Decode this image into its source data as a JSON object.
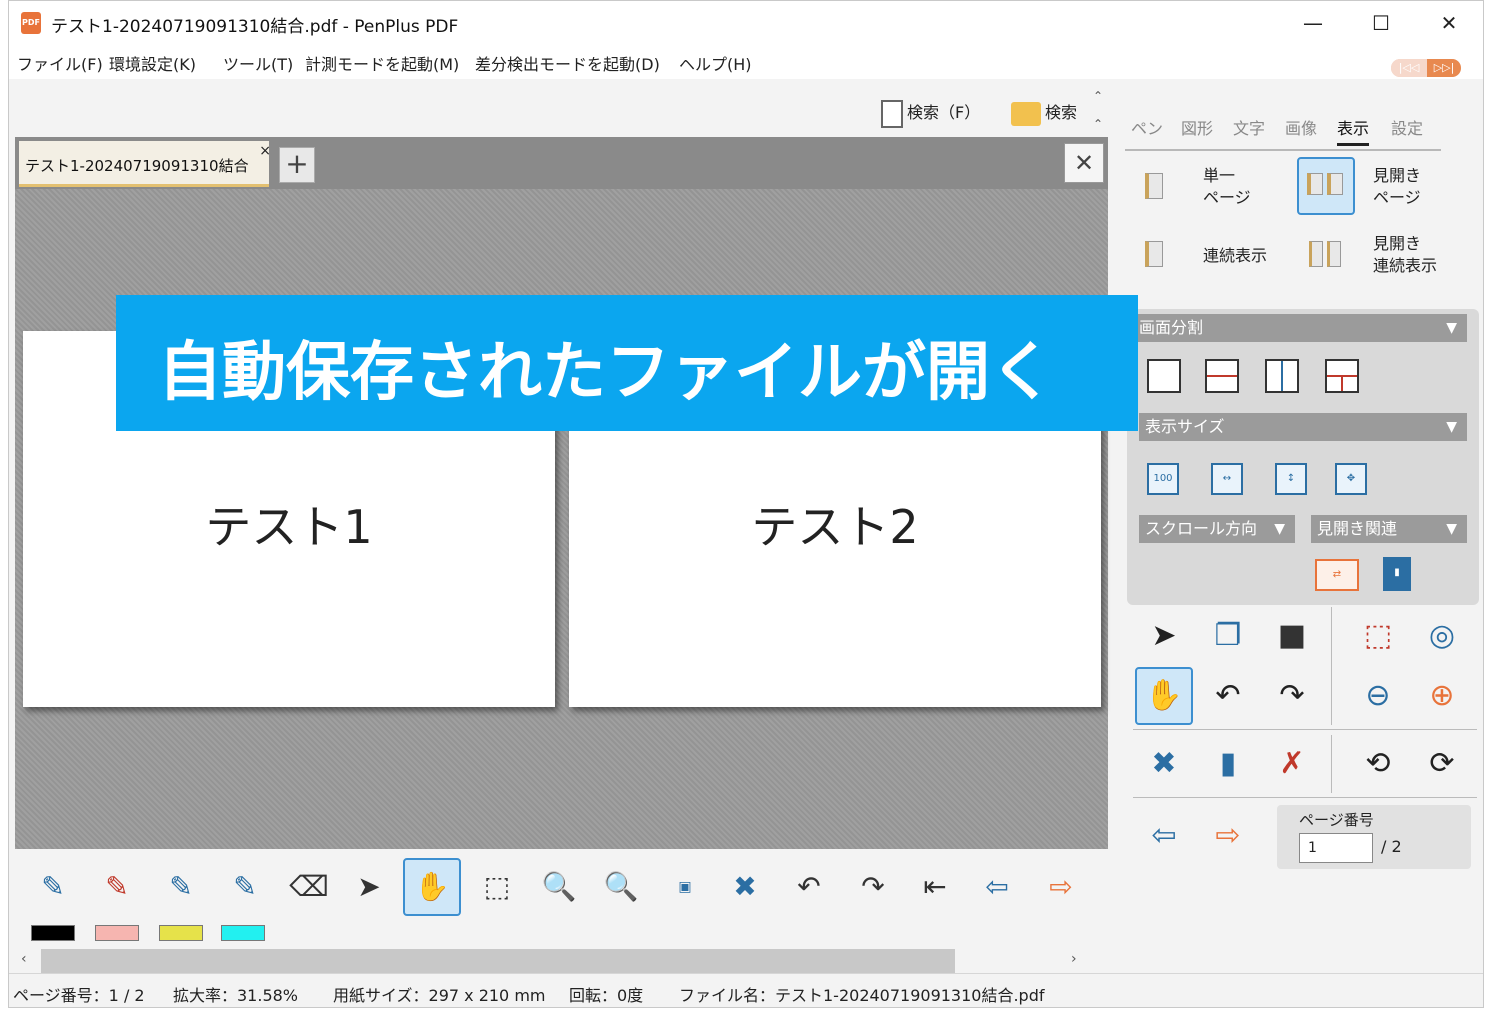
{
  "window": {
    "title": "テスト1-20240719091310結合.pdf - PenPlus PDF",
    "app_icon_label": "PDF",
    "minimize": "—",
    "maximize": "☐",
    "close": "✕"
  },
  "menu": [
    "ファイル(F)",
    "環境設定(K)",
    "ツール(T)",
    "計測モードを起動(M)",
    "差分検出モードを起動(D)",
    "ヘルプ(H)"
  ],
  "nav_pill": {
    "left": "|◁◁",
    "right": "▷▷|"
  },
  "search": {
    "text_search": "検索（F）",
    "folder_search": "検索"
  },
  "tabs": {
    "doc_tab": "テスト1-20240719091310結合",
    "tab_close": "×",
    "add": "+",
    "close_doc": "✕"
  },
  "pages": [
    {
      "text": "テスト1"
    },
    {
      "text": "テスト2"
    }
  ],
  "overlay": {
    "caption": "自動保存されたファイルが開く"
  },
  "panel": {
    "tabs": [
      "ペン",
      "図形",
      "文字",
      "画像",
      "表示",
      "設定"
    ],
    "active_tab": "表示",
    "view_modes": {
      "single_1": "単一",
      "single_2": "ページ",
      "spread_1": "見開き",
      "spread_2": "ページ",
      "continuous": "連続表示",
      "spread_cont_1": "見開き",
      "spread_cont_2": "連続表示"
    },
    "screen_split": "画面分割",
    "display_size": "表示サイズ",
    "scroll_dir": "スクロール方向",
    "spread_related": "見開き関連",
    "page_number_label": "ページ番号",
    "page_number_value": "1",
    "page_total": "/ 2"
  },
  "toolbar": {
    "swatches": [
      "#000000",
      "#f6b5b0",
      "#e6e24a",
      "#22f0f0"
    ]
  },
  "status": {
    "page": "ページ番号：1 / 2",
    "zoom": "拡大率：31.58%",
    "paper": "用紙サイズ：297 x 210 mm",
    "rotation": "回転：0度",
    "filename": "ファイル名：テスト1-20240719091310結合.pdf"
  }
}
